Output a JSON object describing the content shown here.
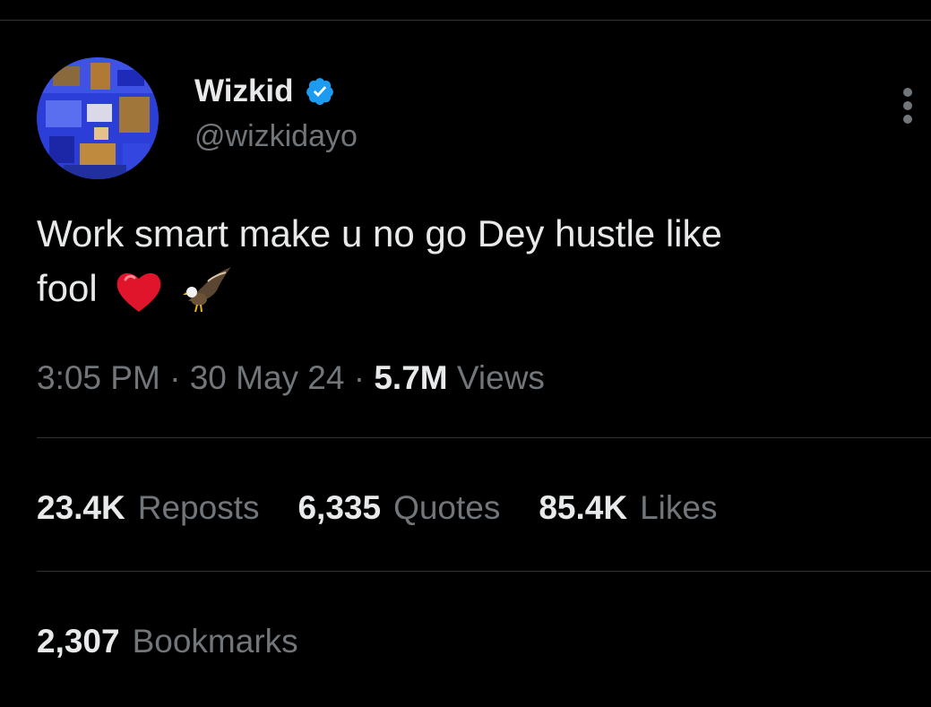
{
  "author": {
    "display_name": "Wizkid",
    "handle": "@wizkidayo",
    "verified": true,
    "verified_color": "#1d9bf0"
  },
  "tweet": {
    "text_line1": "Work smart make u no go Dey hustle like",
    "text_line2": "fool",
    "emojis": [
      "red-heart-emoji",
      "eagle-emoji"
    ]
  },
  "meta": {
    "time": "3:05 PM",
    "separator": "·",
    "date": "30 May 24",
    "views_count": "5.7M",
    "views_label": "Views"
  },
  "stats": {
    "reposts_count": "23.4K",
    "reposts_label": "Reposts",
    "quotes_count": "6,335",
    "quotes_label": "Quotes",
    "likes_count": "85.4K",
    "likes_label": "Likes",
    "bookmarks_count": "2,307",
    "bookmarks_label": "Bookmarks"
  },
  "colors": {
    "background": "#000000",
    "primary_text": "#e7e9ea",
    "secondary_text": "#71767b",
    "divider": "#2f3336"
  }
}
